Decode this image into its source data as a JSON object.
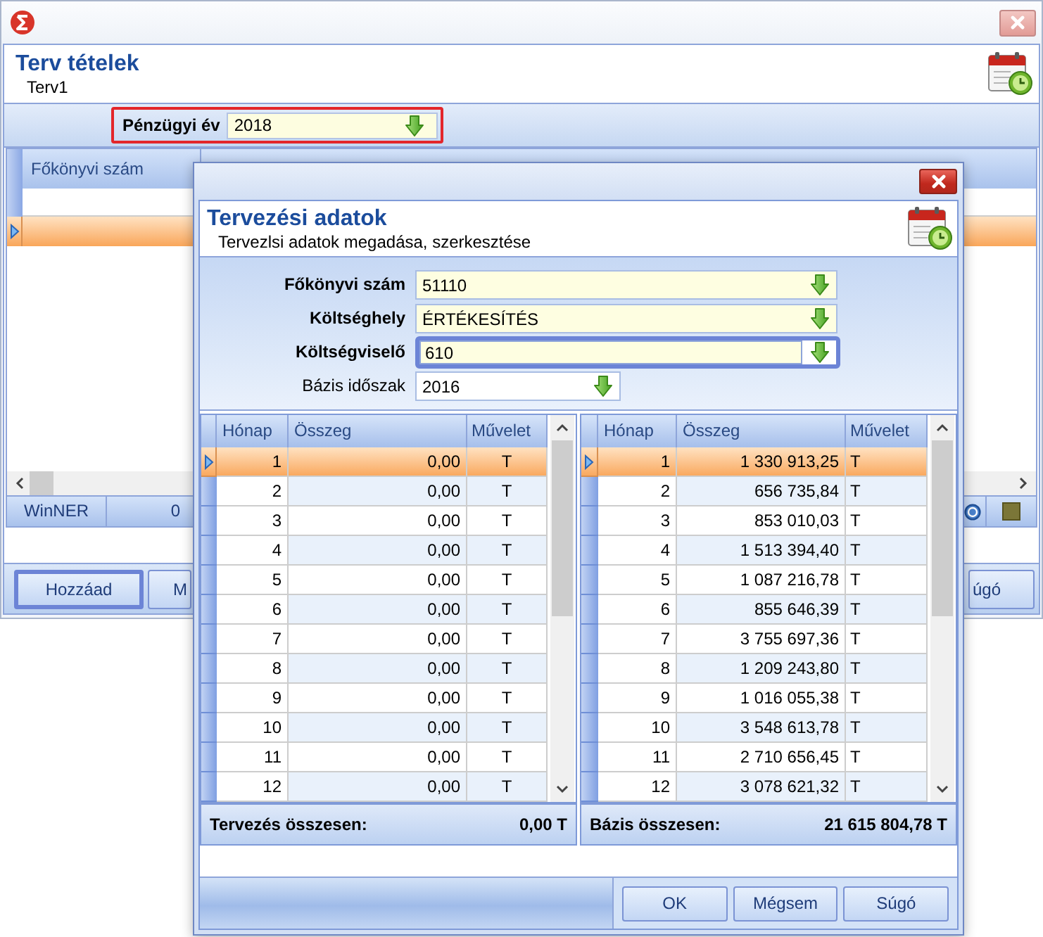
{
  "main_window": {
    "header": {
      "title": "Terv tételek",
      "subtitle": "Terv1"
    },
    "filter": {
      "label": "Pénzügyi év",
      "value": "2018",
      "highlighted": true
    },
    "grid": {
      "columns": [
        "Főkönyvi szám"
      ],
      "rows": [
        {
          "selected": true
        }
      ],
      "footer": [
        "WinNER",
        "0"
      ]
    },
    "buttons": [
      {
        "label": "Hozzáad",
        "focused": true
      },
      {
        "label": "M",
        "focused": false
      },
      {
        "label": "úgó",
        "focused": false
      }
    ]
  },
  "dialog": {
    "title": "Tervezési adatok",
    "subtitle": "Tervezlsi adatok megadása, szerkesztése",
    "fields": [
      {
        "label": "Főkönyvi szám",
        "value": "51110",
        "required": true,
        "focused": false
      },
      {
        "label": "Költséghely",
        "value": "ÉRTÉKESÍTÉS",
        "required": true,
        "focused": false
      },
      {
        "label": "Költségviselő",
        "value": "610",
        "required": true,
        "focused": true
      },
      {
        "label": "Bázis időszak",
        "value": "2016",
        "required": false,
        "focused": false
      }
    ],
    "grids": [
      {
        "columns": [
          "Hónap",
          "Összeg",
          "Művelet"
        ],
        "rows": [
          {
            "month": "1",
            "amount": "0,00",
            "operation": "T",
            "selected": true
          },
          {
            "month": "2",
            "amount": "0,00",
            "operation": "T",
            "selected": false
          },
          {
            "month": "3",
            "amount": "0,00",
            "operation": "T",
            "selected": false
          },
          {
            "month": "4",
            "amount": "0,00",
            "operation": "T",
            "selected": false
          },
          {
            "month": "5",
            "amount": "0,00",
            "operation": "T",
            "selected": false
          },
          {
            "month": "6",
            "amount": "0,00",
            "operation": "T",
            "selected": false
          },
          {
            "month": "7",
            "amount": "0,00",
            "operation": "T",
            "selected": false
          },
          {
            "month": "8",
            "amount": "0,00",
            "operation": "T",
            "selected": false
          },
          {
            "month": "9",
            "amount": "0,00",
            "operation": "T",
            "selected": false
          },
          {
            "month": "10",
            "amount": "0,00",
            "operation": "T",
            "selected": false
          },
          {
            "month": "11",
            "amount": "0,00",
            "operation": "T",
            "selected": false
          },
          {
            "month": "12",
            "amount": "0,00",
            "operation": "T",
            "selected": false
          }
        ],
        "total_label": "Tervezés összesen:",
        "total": "0,00 T"
      },
      {
        "columns": [
          "Hónap",
          "Összeg",
          "Művelet"
        ],
        "rows": [
          {
            "month": "1",
            "amount": "1 330 913,25",
            "operation": "T",
            "selected": true
          },
          {
            "month": "2",
            "amount": "656 735,84",
            "operation": "T",
            "selected": false
          },
          {
            "month": "3",
            "amount": "853 010,03",
            "operation": "T",
            "selected": false
          },
          {
            "month": "4",
            "amount": "1 513 394,40",
            "operation": "T",
            "selected": false
          },
          {
            "month": "5",
            "amount": "1 087 216,78",
            "operation": "T",
            "selected": false
          },
          {
            "month": "6",
            "amount": "855 646,39",
            "operation": "T",
            "selected": false
          },
          {
            "month": "7",
            "amount": "3 755 697,36",
            "operation": "T",
            "selected": false
          },
          {
            "month": "8",
            "amount": "1 209 243,80",
            "operation": "T",
            "selected": false
          },
          {
            "month": "9",
            "amount": "1 016 055,38",
            "operation": "T",
            "selected": false
          },
          {
            "month": "10",
            "amount": "3 548 613,78",
            "operation": "T",
            "selected": false
          },
          {
            "month": "11",
            "amount": "2 710 656,45",
            "operation": "T",
            "selected": false
          },
          {
            "month": "12",
            "amount": "3 078 621,32",
            "operation": "T",
            "selected": false
          }
        ],
        "total_label": "Bázis összesen:",
        "total": "21 615 804,78 T"
      }
    ],
    "buttons": [
      "OK",
      "Mégsem",
      "Súgó"
    ]
  }
}
